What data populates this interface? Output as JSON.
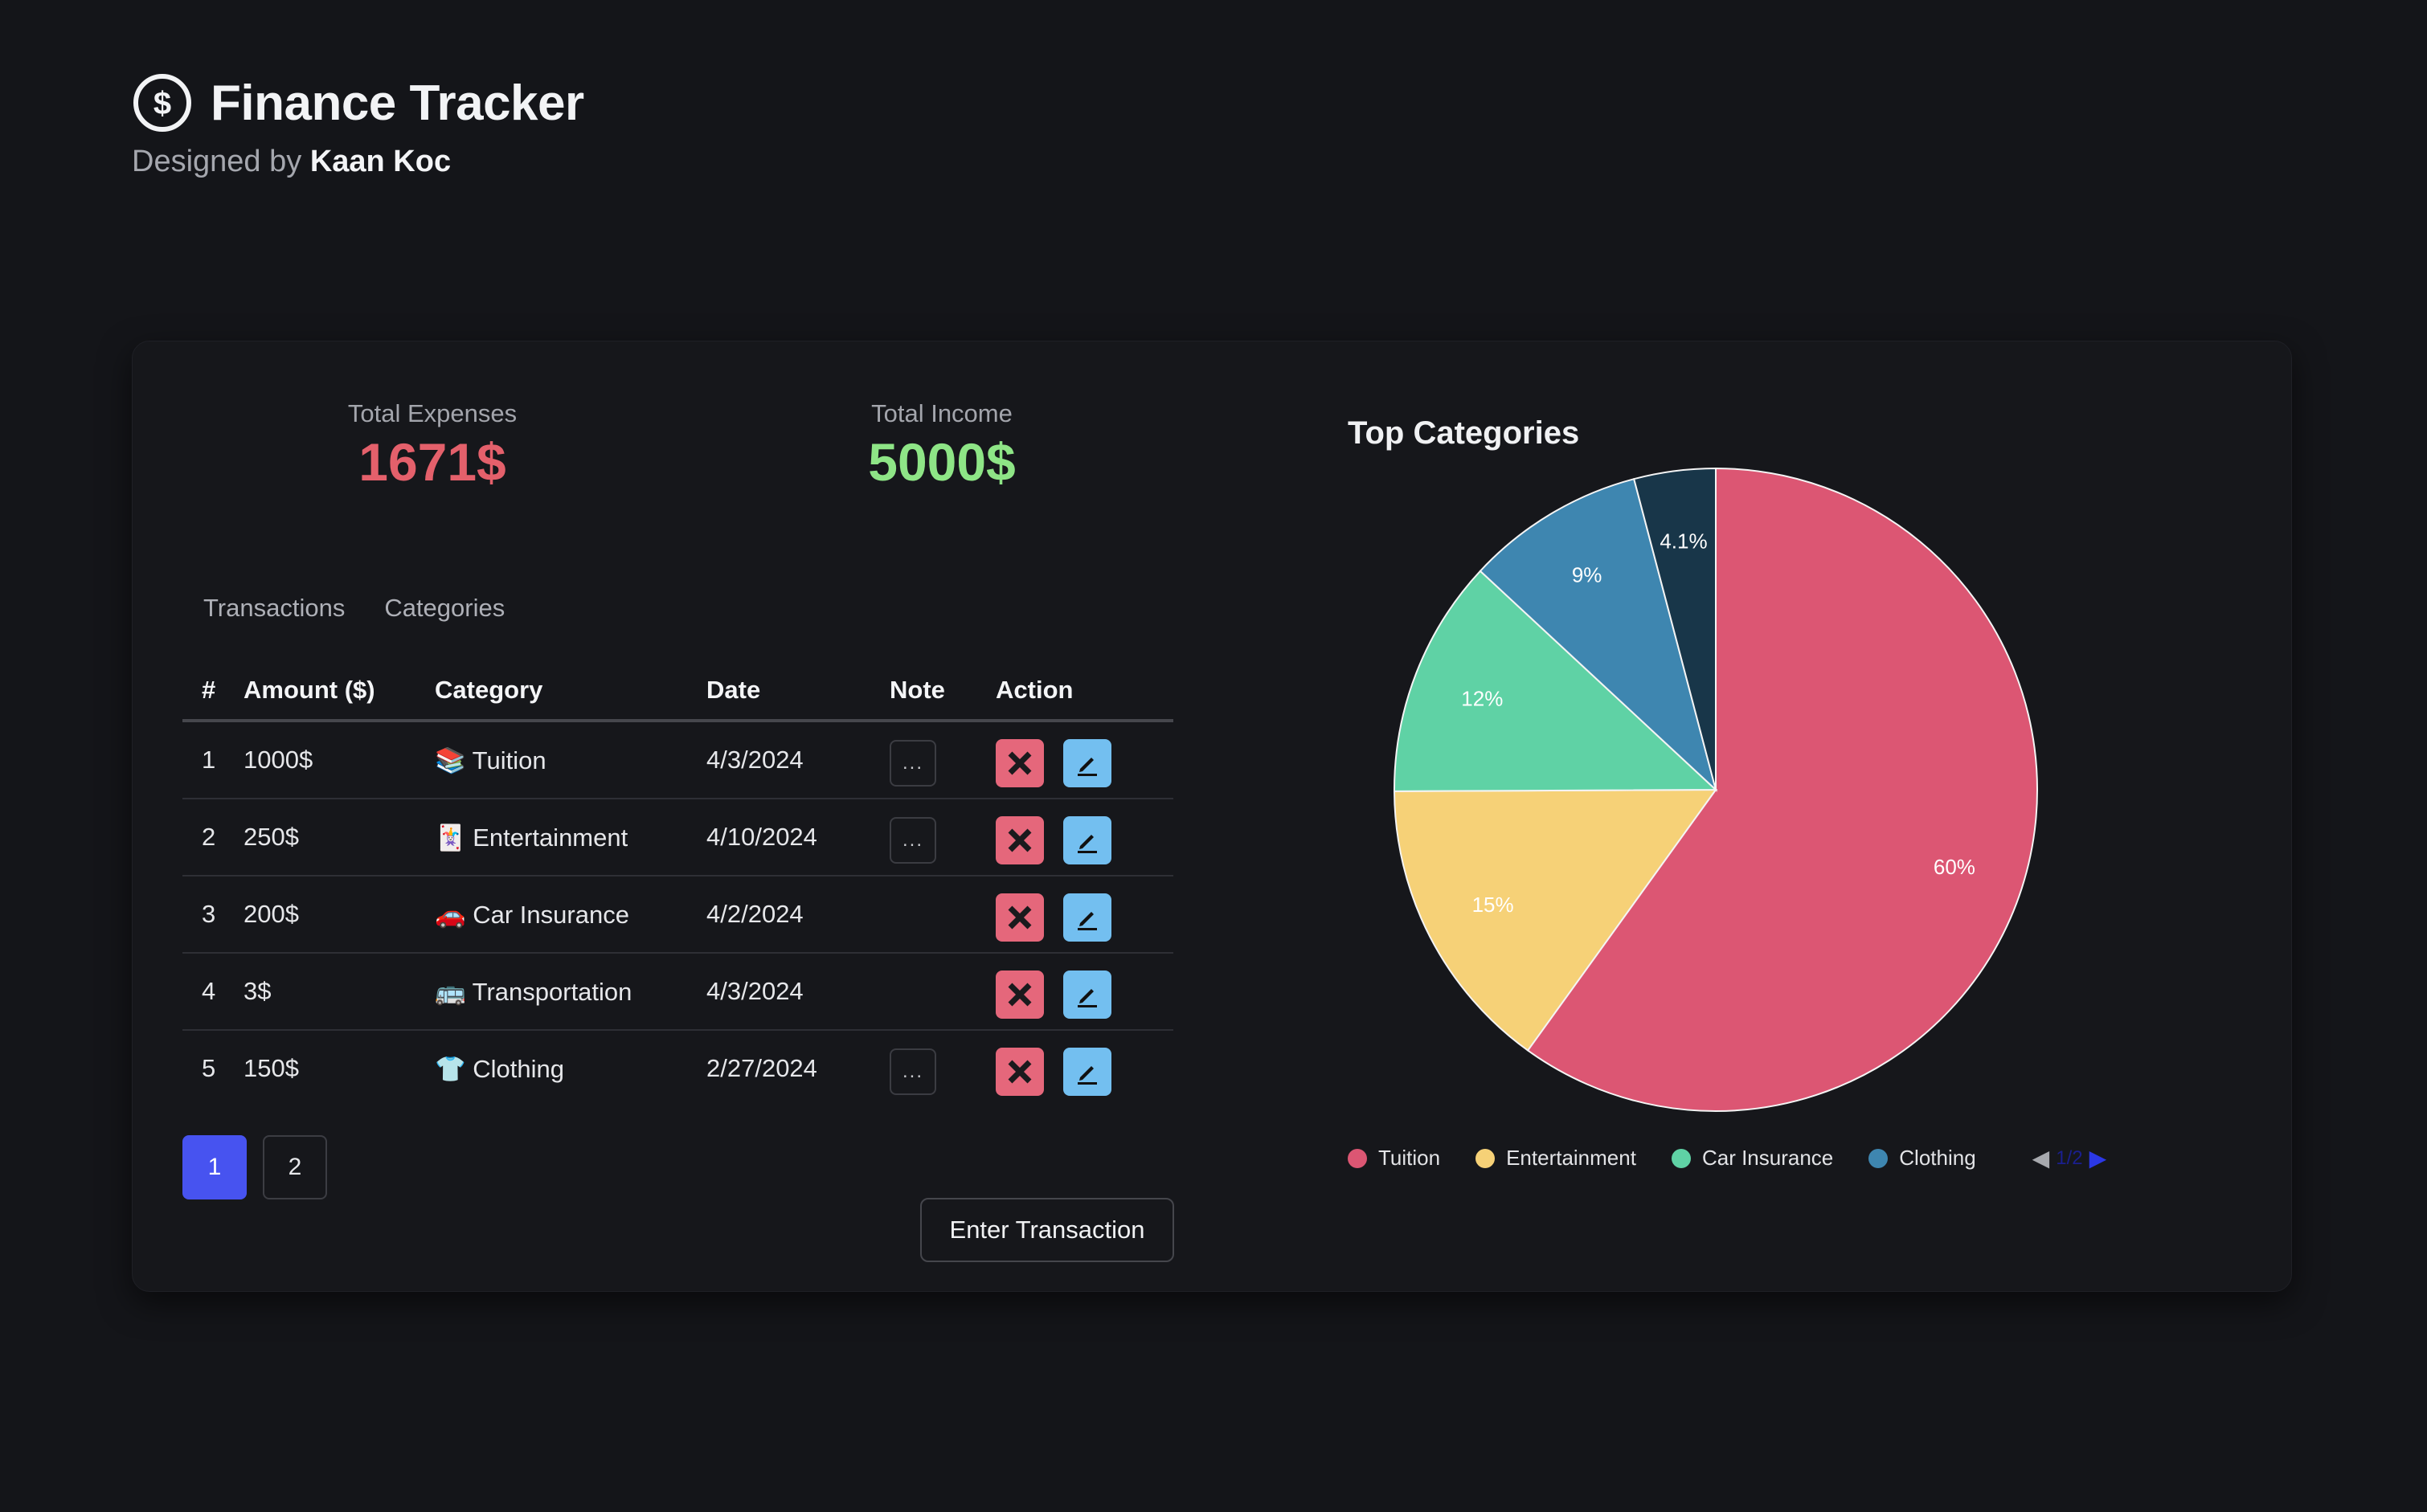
{
  "header": {
    "title": "Finance Tracker",
    "subtitle_prefix": "Designed by",
    "author": "Kaan Koc"
  },
  "stats": {
    "expenses_label": "Total Expenses",
    "expenses_value": "1671$",
    "expenses_color": "#e4606b",
    "income_label": "Total Income",
    "income_value": "5000$",
    "income_color": "#8ee586"
  },
  "tabs": [
    "Transactions",
    "Categories"
  ],
  "table": {
    "headers": [
      "#",
      "Amount ($)",
      "Category",
      "Date",
      "Note",
      "Action"
    ],
    "rows": [
      {
        "num": "1",
        "amount": "1000$",
        "emoji": "📚",
        "category": "Tuition",
        "date": "4/3/2024",
        "note": "...",
        "has_note": true
      },
      {
        "num": "2",
        "amount": "250$",
        "emoji": "🃏",
        "category": "Entertainment",
        "date": "4/10/2024",
        "note": "...",
        "has_note": true
      },
      {
        "num": "3",
        "amount": "200$",
        "emoji": "🚗",
        "category": "Car Insurance",
        "date": "4/2/2024",
        "note": "",
        "has_note": false
      },
      {
        "num": "4",
        "amount": "3$",
        "emoji": "🚌",
        "category": "Transportation",
        "date": "4/3/2024",
        "note": "",
        "has_note": false
      },
      {
        "num": "5",
        "amount": "150$",
        "emoji": "👕",
        "category": "Clothing",
        "date": "2/27/2024",
        "note": "...",
        "has_note": true
      }
    ]
  },
  "pagination": {
    "pages": [
      "1",
      "2"
    ],
    "current": "1"
  },
  "enter_button": "Enter Transaction",
  "chart_title": "Top Categories",
  "chart_data": {
    "type": "pie",
    "title": "Top Categories",
    "slices": [
      {
        "label": "Tuition",
        "value": 60,
        "display": "60%",
        "color": "#dc5673"
      },
      {
        "label": "Entertainment",
        "value": 15,
        "display": "15%",
        "color": "#f6d177"
      },
      {
        "label": "Car Insurance",
        "value": 12,
        "display": "12%",
        "color": "#5fd2a5"
      },
      {
        "label": "Clothing",
        "value": 9,
        "display": "9%",
        "color": "#3e86b0"
      },
      {
        "label": "",
        "value": 4.1,
        "display": "4.1%",
        "color": "#183649"
      }
    ],
    "legend": [
      "Tuition",
      "Entertainment",
      "Car Insurance",
      "Clothing"
    ],
    "legend_position": "bottom",
    "legend_page": "1/2"
  },
  "icons": {
    "logo": "dollar-circle-icon",
    "delete": "close-x-icon",
    "edit": "pencil-icon"
  }
}
